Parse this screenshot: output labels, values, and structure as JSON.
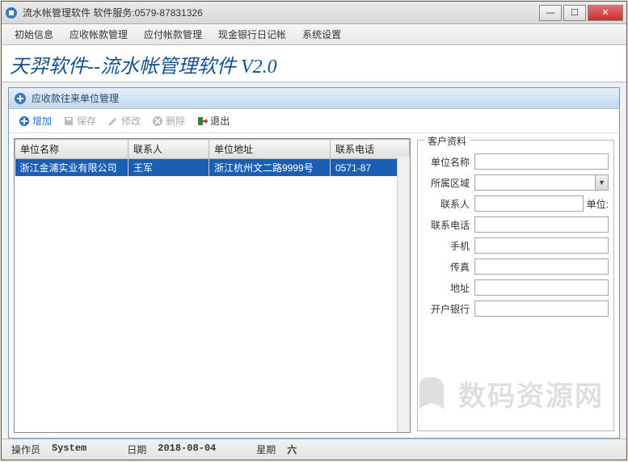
{
  "window": {
    "title": "流水帐管理软件    软件服务:0579-87831326"
  },
  "menu": {
    "items": [
      "初始信息",
      "应收帐款管理",
      "应付帐款管理",
      "现金银行日记帐",
      "系统设置"
    ]
  },
  "app_title": "天羿软件--流水帐管理软件  V2.0",
  "subwindow": {
    "title": "应收款往来单位管理"
  },
  "toolbar": {
    "add": "增加",
    "save": "保存",
    "edit": "修改",
    "del": "删除",
    "exit": "退出"
  },
  "grid": {
    "cols": [
      "单位名称",
      "联系人",
      "单位地址",
      "联系电话"
    ],
    "row": {
      "c0": "浙江金浦实业有限公司",
      "c1": "王军",
      "c2": "浙江杭州文二路9999号",
      "c3": "0571-87"
    }
  },
  "form": {
    "legend": "客户资料",
    "f0": "单位名称",
    "f1": "所属区域",
    "f2": "联系人",
    "f2_trail": "单位:",
    "f3": "联系电话",
    "f4": "手机",
    "f5": "传真",
    "f6": "地址",
    "f7": "开户银行"
  },
  "status": {
    "op_label": "操作员",
    "op_value": "System",
    "date_label": "日期",
    "date_value": "2018-08-04",
    "week_label": "星期",
    "week_value": "六"
  },
  "watermark": "数码资源网"
}
